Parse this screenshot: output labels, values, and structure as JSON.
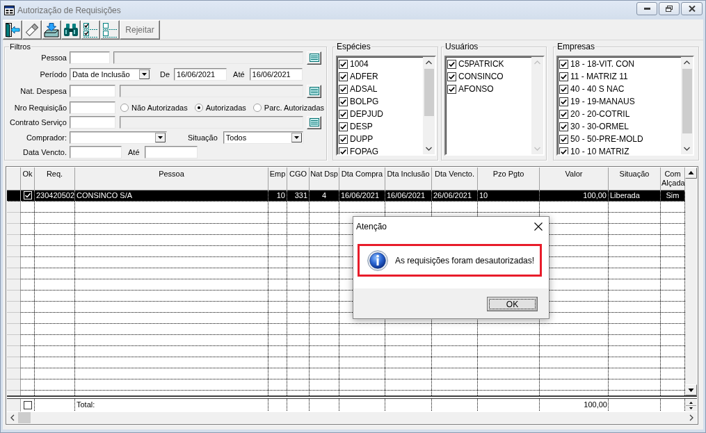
{
  "window": {
    "title": "Autorização de Requisições"
  },
  "toolbar": {
    "reject_button": {
      "label": "Rejeitar",
      "disabled": true
    }
  },
  "filters": {
    "title": "Filtros",
    "pessoa": {
      "label": "Pessoa"
    },
    "periodo": {
      "label": "Período",
      "value": "Data de Inclusão",
      "from_label": "De",
      "from_value": "16/06/2021",
      "to_label": "Até",
      "to_value": "16/06/2021"
    },
    "nat_despesa": {
      "label": "Nat. Despesa"
    },
    "nro_requisicao": {
      "label": "Nro Requisição",
      "options": [
        {
          "label": "Não Autorizadas",
          "selected": false
        },
        {
          "label": "Autorizadas",
          "selected": true
        },
        {
          "label": "Parc. Autorizadas",
          "selected": false
        }
      ]
    },
    "contrato_servico": {
      "label": "Contrato Serviço"
    },
    "comprador": {
      "label": "Comprador:"
    },
    "situacao": {
      "label": "Situação",
      "value": "Todos"
    },
    "data_vencto": {
      "label": "Data Vencto.",
      "to_label": "Até"
    }
  },
  "lists": [
    {
      "title": "Espécies",
      "scrollable": true,
      "items": [
        {
          "label": "1004",
          "checked": true
        },
        {
          "label": "ADFER",
          "checked": true
        },
        {
          "label": "ADSAL",
          "checked": true
        },
        {
          "label": "BOLPG",
          "checked": true
        },
        {
          "label": "DEPJUD",
          "checked": true
        },
        {
          "label": "DESP",
          "checked": true
        },
        {
          "label": "DUPP",
          "checked": true
        },
        {
          "label": "FOPAG",
          "checked": true
        }
      ]
    },
    {
      "title": "Usuários",
      "scrollable": false,
      "items": [
        {
          "label": "C5PATRICK",
          "checked": true
        },
        {
          "label": "CONSINCO",
          "checked": true
        },
        {
          "label": "AFONSO",
          "checked": true
        }
      ]
    },
    {
      "title": "Empresas",
      "scrollable": true,
      "items": [
        {
          "label": "18 - 18-VIT. CON",
          "checked": true
        },
        {
          "label": "11 - MATRIZ 11",
          "checked": true
        },
        {
          "label": "40 - 40 S NAC",
          "checked": true
        },
        {
          "label": "19 - 19-MANAUS",
          "checked": true
        },
        {
          "label": "20 - 20-COTRIL",
          "checked": true
        },
        {
          "label": "30 - 30-ORMEL",
          "checked": true
        },
        {
          "label": "50 - 50-PRE-MOLD",
          "checked": true
        },
        {
          "label": "10 - 10 MATRIZ",
          "checked": true
        }
      ]
    }
  ],
  "grid": {
    "check_column": "Ok",
    "columns": [
      "Req.",
      "Pessoa",
      "Emp",
      "CGO",
      "Nat Dsp",
      "Dta Compra",
      "Dta Inclusão",
      "Dta Vencto.",
      "Pzo Pgto",
      "Valor",
      "Situação",
      "Com Alçada"
    ],
    "rows": [
      {
        "selected": true,
        "checked": true,
        "cells": [
          "230420502",
          "CONSINCO S/A",
          "10",
          "331",
          "4",
          "16/06/2021",
          "16/06/2021",
          "26/06/2021",
          "10",
          "100,00",
          "Liberada",
          "Sim"
        ]
      }
    ],
    "footer": {
      "checked": false,
      "label": "Total:",
      "value": "100,00"
    }
  },
  "dialog": {
    "title": "Atenção",
    "message": "As requisições foram desautorizadas!",
    "button": "OK"
  }
}
